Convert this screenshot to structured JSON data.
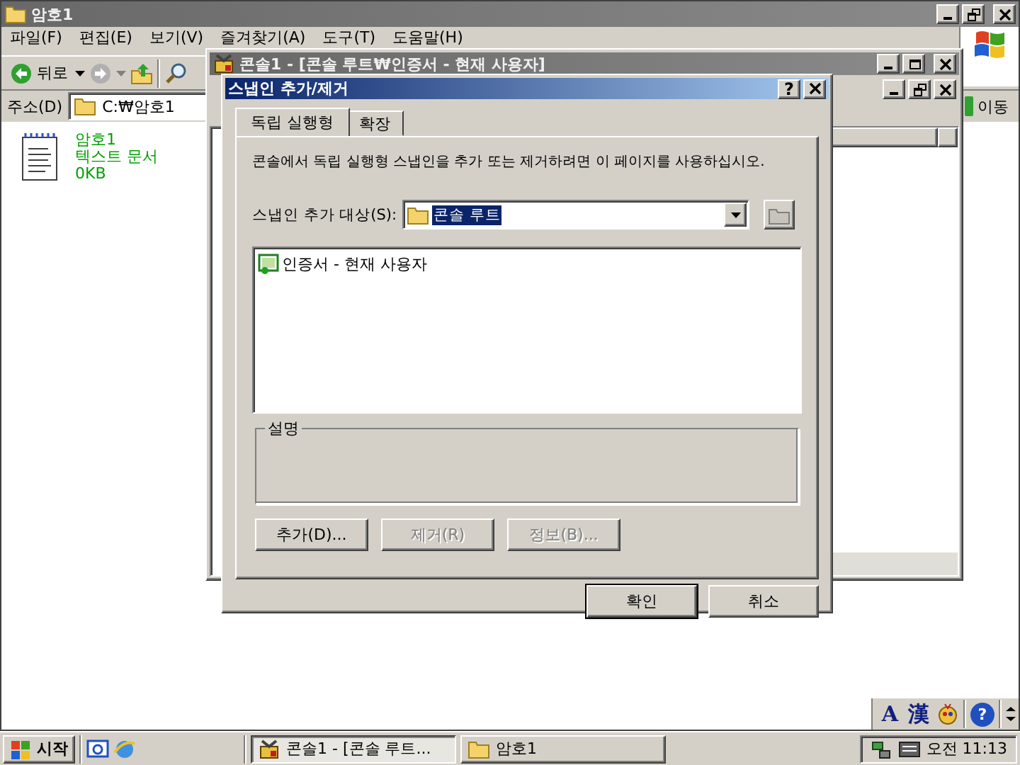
{
  "explorer": {
    "title": "암호1",
    "menu": [
      "파일(F)",
      "편집(E)",
      "보기(V)",
      "즐겨찾기(A)",
      "도구(T)",
      "도움말(H)"
    ],
    "back_label": "뒤로",
    "address": {
      "label": "주소(D)",
      "value": "C:₩암호1",
      "go": "이동"
    },
    "files": [
      {
        "name": "암호1",
        "type": "텍스트 문서",
        "size": "0KB",
        "encrypted": true
      }
    ]
  },
  "console": {
    "title": "콘솔1 - [콘솔 루트₩인증서 - 현재 사용자]"
  },
  "dialog": {
    "title": "스냅인 추가/제거",
    "help": "?",
    "tabs": [
      {
        "label": "독립 실행형",
        "selected": true
      },
      {
        "label": "확장",
        "selected": false
      }
    ],
    "intro": "콘솔에서 독립 실행형 스냅인을 추가 또는 제거하려면 이 페이지를 사용하십시오.",
    "target_label": "스냅인 추가 대상(S):",
    "target_value": "콘솔 루트",
    "snapins": [
      {
        "name": "인증서 - 현재 사용자",
        "selected": false
      }
    ],
    "description_label": "설명",
    "actions": [
      {
        "label": "추가(D)...",
        "disabled": false
      },
      {
        "label": "제거(R)",
        "disabled": true
      },
      {
        "label": "정보(B)...",
        "disabled": true
      }
    ],
    "buttons": [
      {
        "label": "확인",
        "default": true
      },
      {
        "label": "취소",
        "default": false
      }
    ]
  },
  "language_bar": {
    "items": [
      "A",
      "漢"
    ],
    "help": "?"
  },
  "taskbar": {
    "start": "시작",
    "tasks": [
      {
        "label": "콘솔1 - [콘솔 루트...",
        "selected": true,
        "kind": "console"
      },
      {
        "label": "암호1",
        "selected": false,
        "kind": "folder"
      }
    ],
    "clock": "오전 11:13"
  }
}
